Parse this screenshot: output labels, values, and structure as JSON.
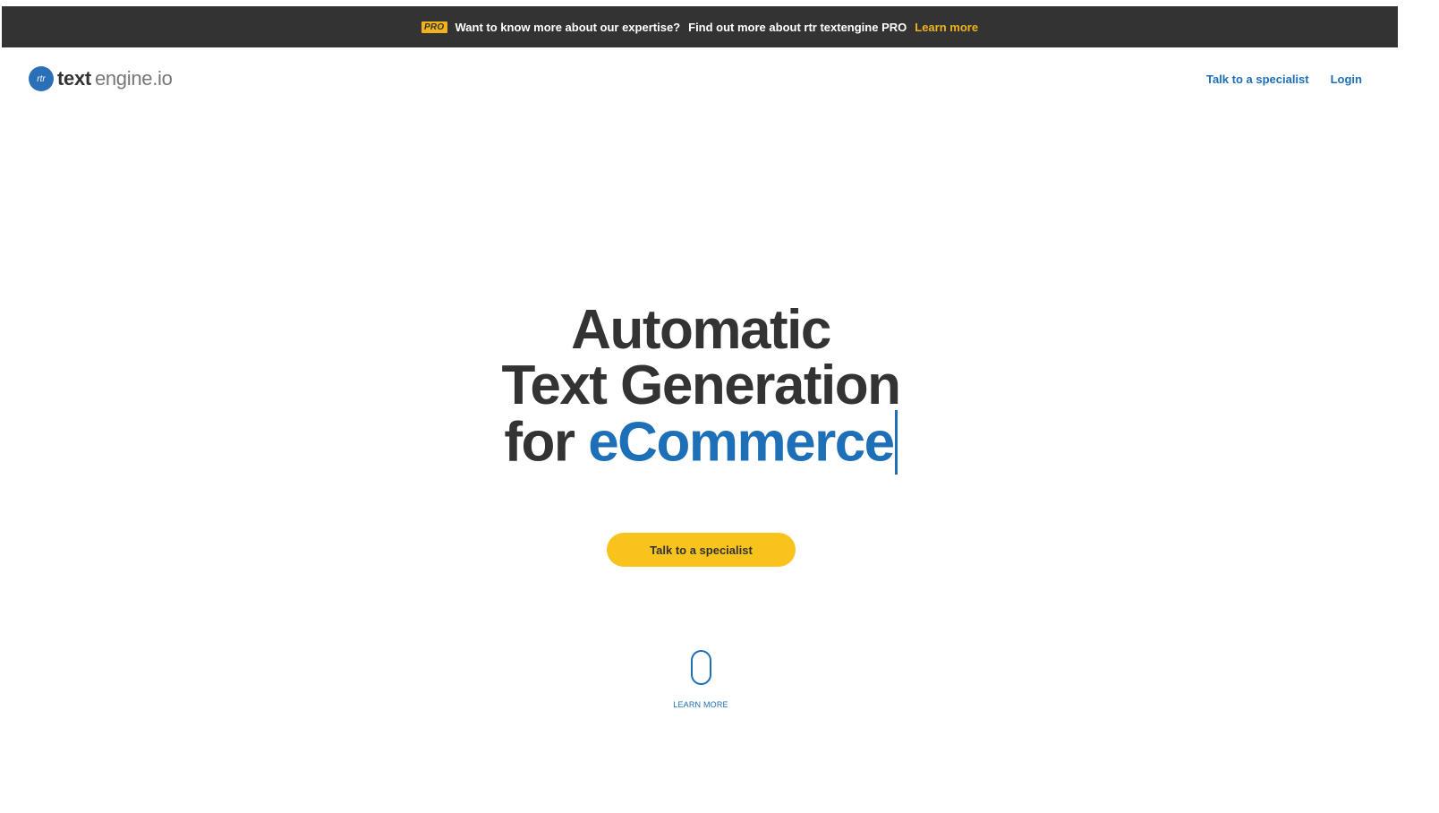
{
  "banner": {
    "badge": "PRO",
    "question": "Want to know more about our expertise?",
    "promo": "Find out more about rtr textengine PRO",
    "link_label": "Learn more"
  },
  "header": {
    "logo": {
      "mark": "rtr",
      "bold": "text",
      "light": "engine.io"
    },
    "nav": {
      "specialist": "Talk to a specialist",
      "login": "Login"
    }
  },
  "hero": {
    "line1": "Automatic",
    "line2": "Text Generation",
    "line3_prefix": "for",
    "line3_accent": "eCommerce"
  },
  "cta": {
    "label": "Talk to a specialist"
  },
  "scroll": {
    "label": "LEARN MORE"
  },
  "colors": {
    "banner_bg": "#333333",
    "accent_yellow": "#f7c31c",
    "accent_blue": "#1d6fb8",
    "text_dark": "#333333"
  }
}
